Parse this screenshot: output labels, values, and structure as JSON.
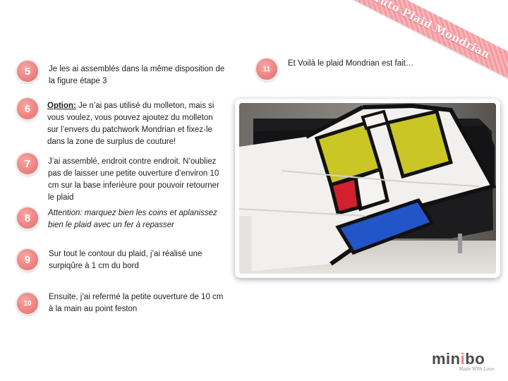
{
  "ribbon": {
    "text": "Tuto Plaid Mondrian"
  },
  "steps": [
    {
      "number": "5",
      "text": "Je les ai assemblés dans la même disposition de la figure étape 3"
    },
    {
      "number": "6",
      "label": "Option:",
      "text": " Je n’ai pas utilisé du molleton, mais si vous voulez, vous pouvez ajoutez du molleton sur l’envers du patchwork Mondrian et fixez-le dans la zone de surplus de couture!"
    },
    {
      "number": "7",
      "text": "J’ai assemblé, endroit contre endroit. N’oubliez pas de laisser une petite ouverture d’environ 10 cm sur la base inferièure pour pouvoir retourner le plaid"
    },
    {
      "number": "8",
      "text": "Attention: marquez bien les coins et aplanissez bien le plaid avec un fer à repasser"
    },
    {
      "number": "9",
      "text": "Sur tout le contour du plaid, j’ai réalisé une surpiqûre à 1 cm du bord"
    },
    {
      "number": "10",
      "text": "Ensuite, j’ai refermé la petite ouverture de 10 cm à la main au point feston"
    },
    {
      "number": "11",
      "text": "Et Voilà le plaid Mondrian est fait…"
    }
  ],
  "logo": {
    "prefix": "min",
    "accent": "i",
    "suffix": "bo",
    "tagline": "Made With Love"
  },
  "colors": {
    "badge": "#ef8482",
    "ribbon": "#f49aa0",
    "mondrian_yellow": "#c9c626",
    "mondrian_red": "#d3202f",
    "mondrian_blue": "#2255c8"
  },
  "images": {
    "photo": "mondrian-plaid-on-black-sofa"
  }
}
